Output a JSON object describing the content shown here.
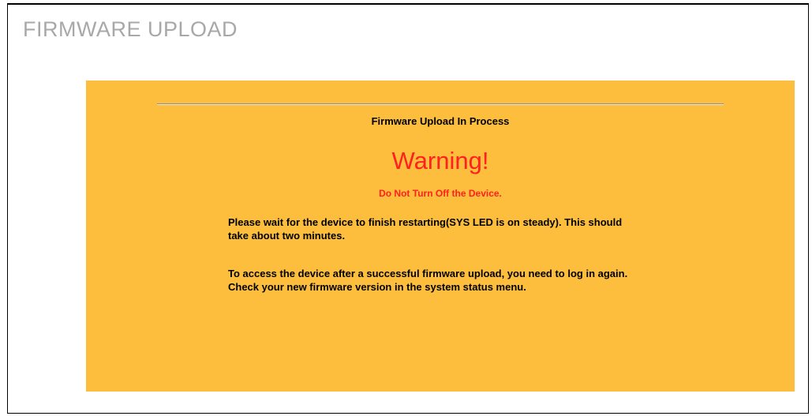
{
  "page": {
    "title": "FIRMWARE UPLOAD"
  },
  "panel": {
    "process_title": "Firmware Upload In Process",
    "warning_title": "Warning!",
    "warning_subtitle": "Do Not Turn Off the Device.",
    "message_wait": "Please wait for the device to finish restarting(SYS LED is on steady). This should take about two minutes.",
    "message_access": "To access the device after a successful firmware upload, you need to log in again. Check your new firmware version in the system status menu."
  },
  "colors": {
    "panel_background": "#fcbe3c",
    "warning_text": "#ff2020",
    "title_text": "#a8a8a8"
  }
}
